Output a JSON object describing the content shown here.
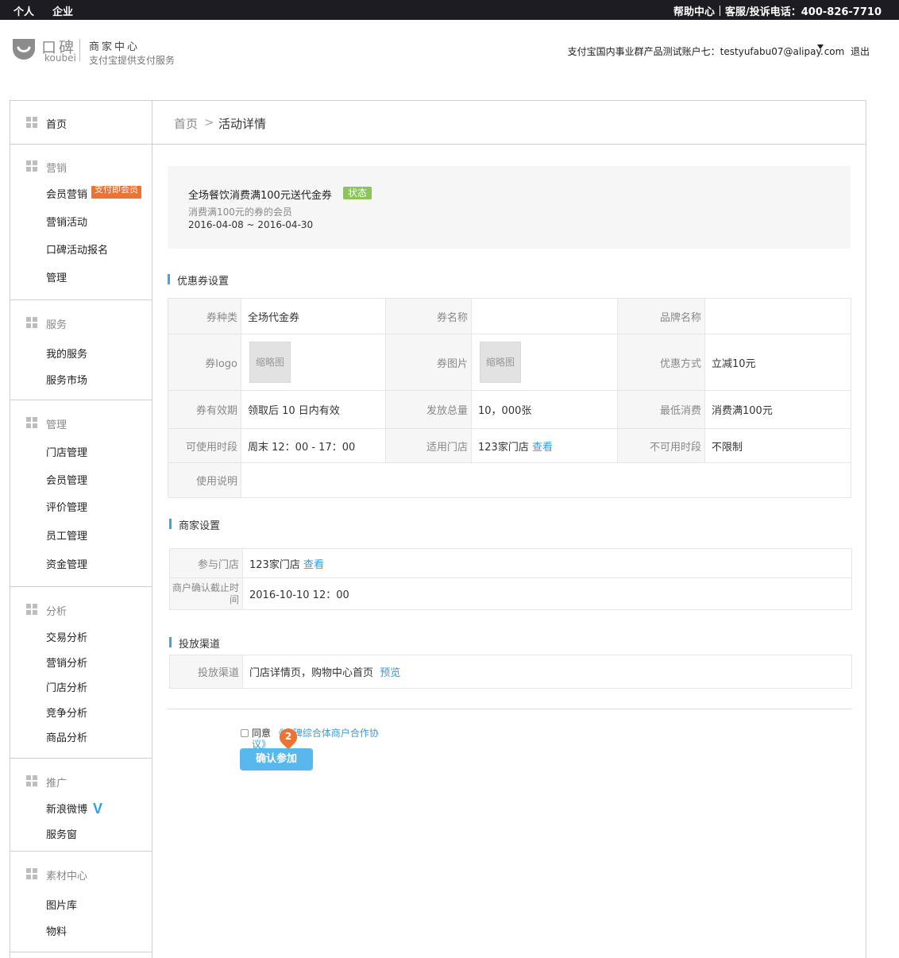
{
  "topbar": {
    "left_items": [
      "个人",
      "企业"
    ],
    "help": "帮助中心",
    "hotline": "客服/投诉电话：400-826-7710"
  },
  "header": {
    "logo_cn": "口碑",
    "logo_en": "koubei",
    "title": "商家中心",
    "subtitle": "支付宝提供支付服务",
    "account_prefix": "支付宝国内事业群产品测试账户七：testyufabu07@alipay.",
    "account_suffix": "com",
    "logout": "退出"
  },
  "sidebar": {
    "home": "首页",
    "groups": [
      {
        "title": "营销",
        "items": [
          "会员营销",
          "营销活动",
          "口碑活动报名",
          "管理"
        ],
        "badge": "支付即会员"
      },
      {
        "title": "服务",
        "items": [
          "我的服务",
          "服务市场"
        ]
      },
      {
        "title": "管理",
        "items": [
          "门店管理",
          "会员管理",
          "评价管理",
          "员工管理",
          "资金管理"
        ]
      },
      {
        "title": "分析",
        "items": [
          "交易分析",
          "营销分析",
          "门店分析",
          "竞争分析",
          "商品分析"
        ]
      },
      {
        "title": "推广",
        "items": [
          "新浪微博",
          "服务窗"
        ],
        "weibo_mark": "V"
      },
      {
        "title": "素材中心",
        "items": [
          "图片库",
          "物料"
        ]
      }
    ]
  },
  "breadcrumb": {
    "home": "首页",
    "sep": ">",
    "current": "活动详情"
  },
  "summary": {
    "title": "全场餐饮消费满100元送代金券",
    "status": "状态",
    "desc": "消费满100元的券的会员",
    "dates": "2016-04-08  ~ 2016-04-30"
  },
  "coupon": {
    "section": "优惠券设置",
    "type_label": "券种类",
    "type_value": "全场代金券",
    "name_label": "券名称",
    "name_value": "",
    "brand_label": "品牌名称",
    "brand_value": "",
    "logo_label": "券logo",
    "logo_thumb": "缩略图",
    "image_label": "券图片",
    "image_thumb": "缩略图",
    "discount_label": "优惠方式",
    "discount_value": "立减10元",
    "validity_label": "券有效期",
    "validity_value": "领取后 10 日内有效",
    "total_label": "发放总量",
    "total_value": "10，000张",
    "min_label": "最低消费",
    "min_value": "消费满100元",
    "period_label": "可使用时段",
    "period_value": "周末   12：00 - 17：00",
    "stores_label": "适用门店",
    "stores_value": "123家门店",
    "stores_link": "查看",
    "unavail_label": "不可用时段",
    "unavail_value": "不限制",
    "usage_label": "使用说明",
    "usage_value": ""
  },
  "merchant": {
    "section": "商家设置",
    "stores_label": "参与门店",
    "stores_value": "123家门店",
    "stores_link": "查看",
    "deadline_label": "商户确认截止时间",
    "deadline_value": "2016-10-10 12：00"
  },
  "channel": {
    "section": "投放渠道",
    "label": "投放渠道",
    "value": "门店详情页，购物中心首页",
    "preview": "预览"
  },
  "footer": {
    "agree": "同意",
    "agreement_prefix": "《",
    "agreement_hidden": "口碑",
    "agreement_link": "综合体商户合作协议》",
    "step_number": "2",
    "confirm": "确认参加"
  }
}
